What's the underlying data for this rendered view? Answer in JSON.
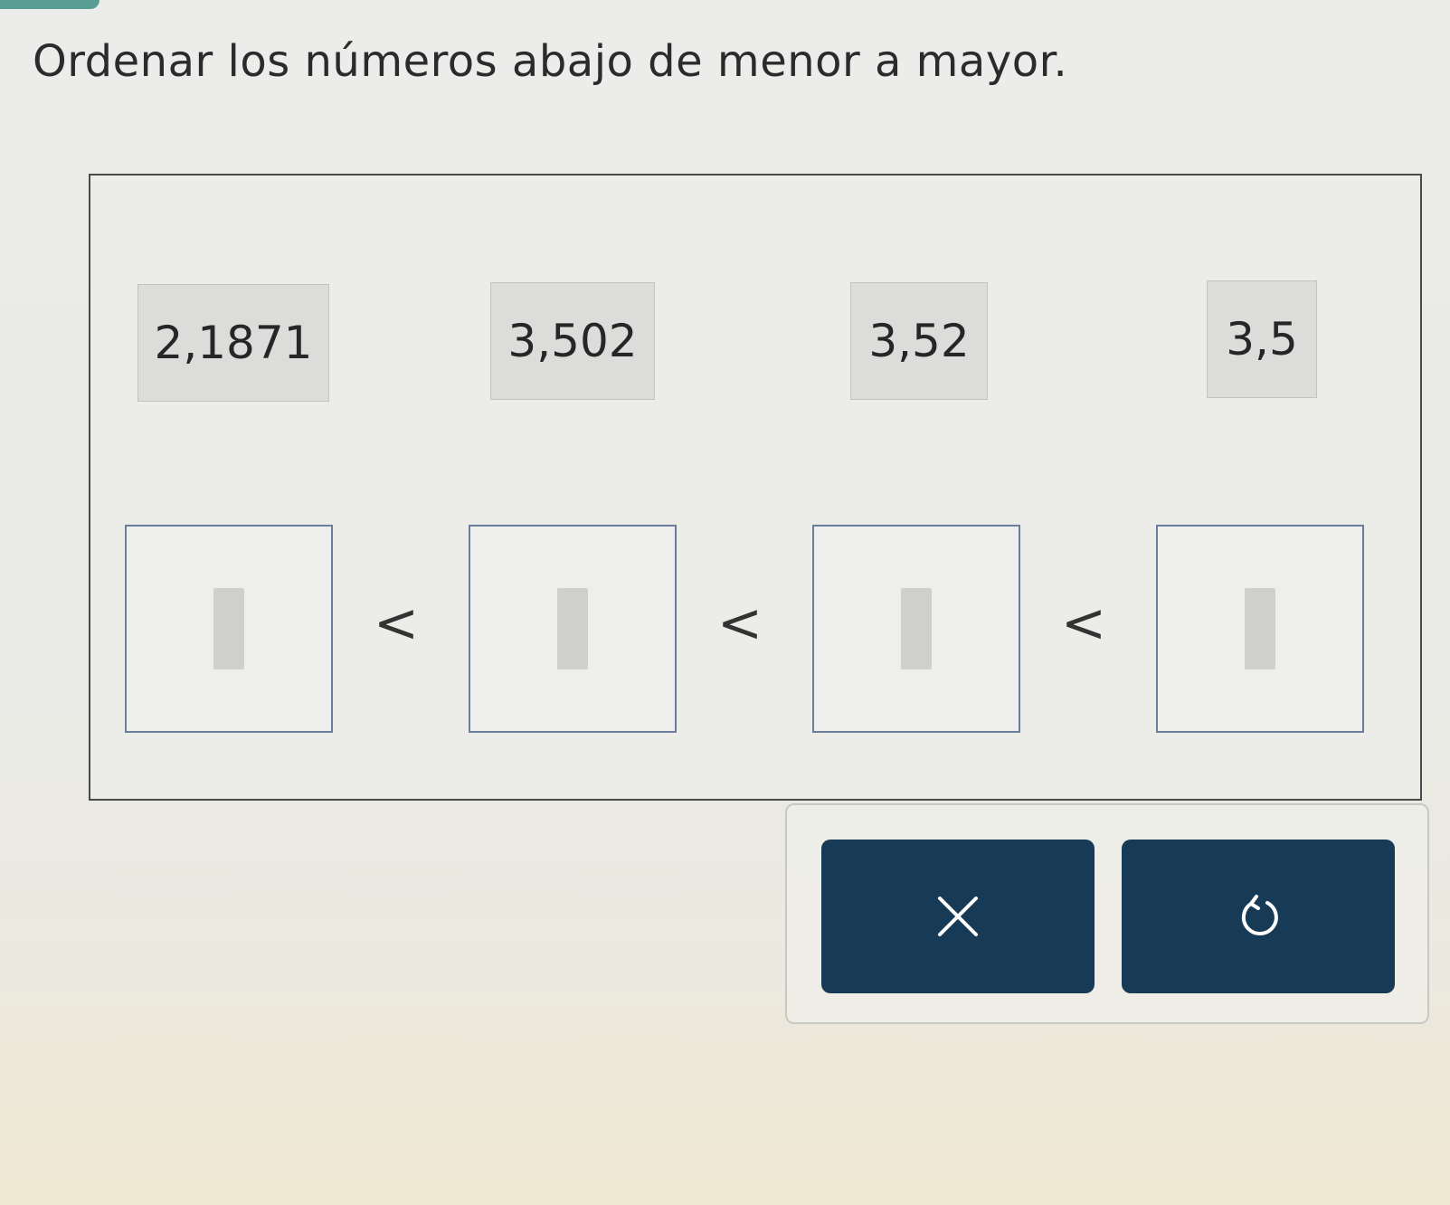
{
  "prompt": "Ordenar los números abajo de menor a mayor.",
  "tiles": [
    "2,1871",
    "3,502",
    "3,52",
    "3,5"
  ],
  "slots_count": 4,
  "comparison_symbol": "<",
  "buttons": {
    "clear_icon": "close-icon",
    "undo_icon": "undo-icon"
  },
  "colors": {
    "button_bg": "#173b57",
    "slot_border": "#6b7d9a"
  }
}
